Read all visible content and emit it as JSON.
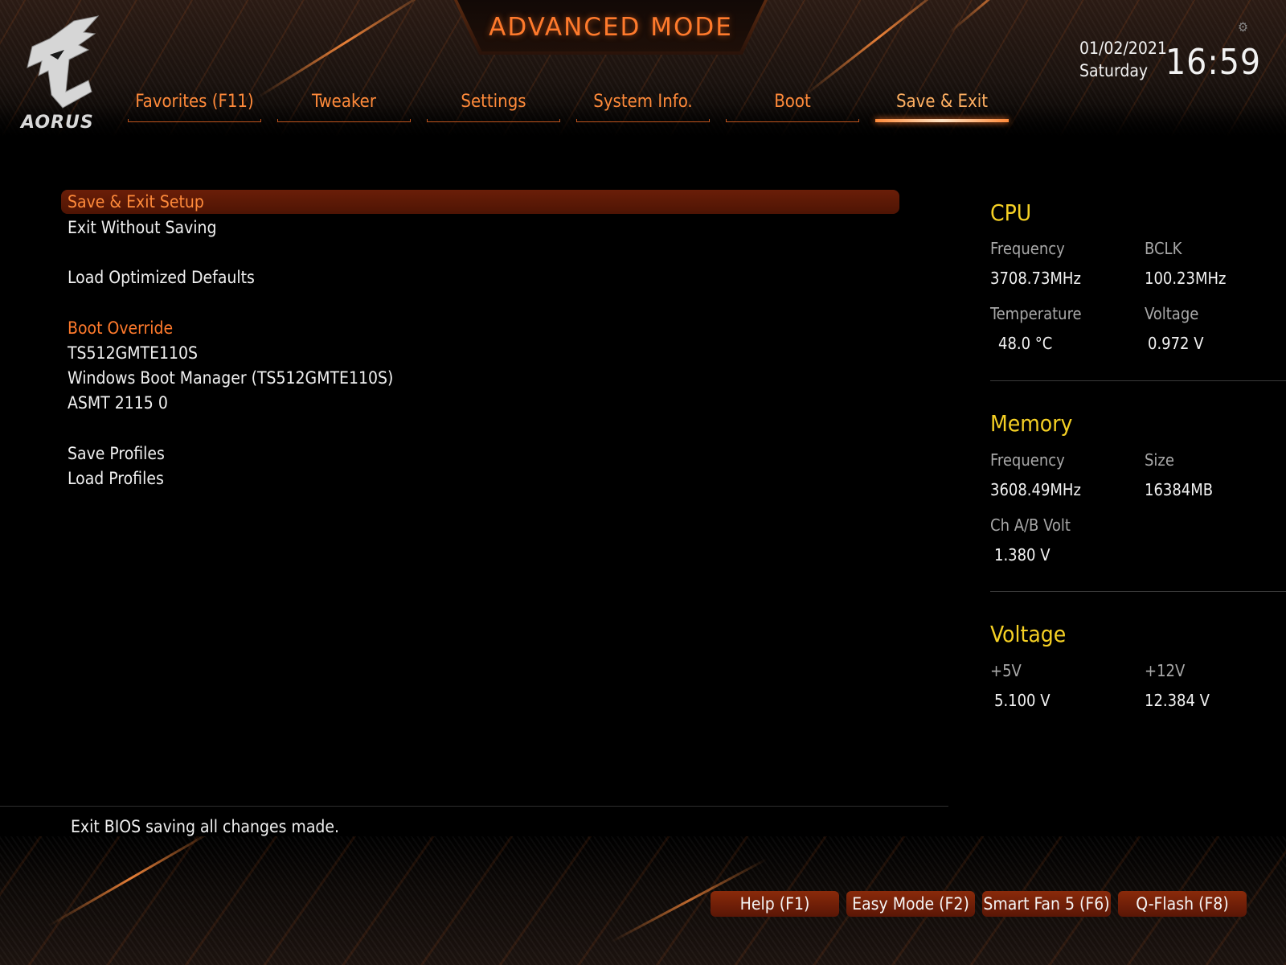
{
  "header": {
    "mode_title": "ADVANCED MODE",
    "logo_text": "AORUS",
    "date": "01/02/2021",
    "day": "Saturday",
    "time": "16:59"
  },
  "tabs": [
    {
      "label": "Favorites (F11)",
      "active": false
    },
    {
      "label": "Tweaker",
      "active": false
    },
    {
      "label": "Settings",
      "active": false
    },
    {
      "label": "System Info.",
      "active": false
    },
    {
      "label": "Boot",
      "active": false
    },
    {
      "label": "Save & Exit",
      "active": true
    }
  ],
  "menu": {
    "save_exit_setup": "Save & Exit Setup",
    "exit_without_saving": "Exit Without Saving",
    "load_optimized_defaults": "Load Optimized Defaults",
    "boot_override_heading": "Boot Override",
    "boot_devices": [
      "TS512GMTE110S",
      "Windows Boot Manager (TS512GMTE110S)",
      "ASMT 2115 0"
    ],
    "save_profiles": "Save Profiles",
    "load_profiles": "Load Profiles"
  },
  "panel": {
    "cpu": {
      "title": "CPU",
      "frequency_label": "Frequency",
      "frequency": "3708.73MHz",
      "bclk_label": "BCLK",
      "bclk": "100.23MHz",
      "temperature_label": "Temperature",
      "temperature": "48.0 °C",
      "voltage_label": "Voltage",
      "voltage": "0.972 V"
    },
    "memory": {
      "title": "Memory",
      "frequency_label": "Frequency",
      "frequency": "3608.49MHz",
      "size_label": "Size",
      "size": "16384MB",
      "ch_volt_label": "Ch A/B Volt",
      "ch_volt": "1.380 V"
    },
    "voltage": {
      "title": "Voltage",
      "plus5_label": "+5V",
      "plus5": "5.100 V",
      "plus12_label": "+12V",
      "plus12": "12.384 V"
    }
  },
  "help_text": "Exit BIOS saving all changes made.",
  "function_buttons": [
    "Help (F1)",
    "Easy Mode (F2)",
    "Smart Fan 5 (F6)",
    "Q-Flash (F8)"
  ],
  "colors": {
    "accent": "#ff7a2c",
    "section_title": "#f5d024",
    "selected_row": "#5a1806"
  },
  "icons": {
    "settings": "gear-icon",
    "logo": "aorus-eagle-logo"
  }
}
